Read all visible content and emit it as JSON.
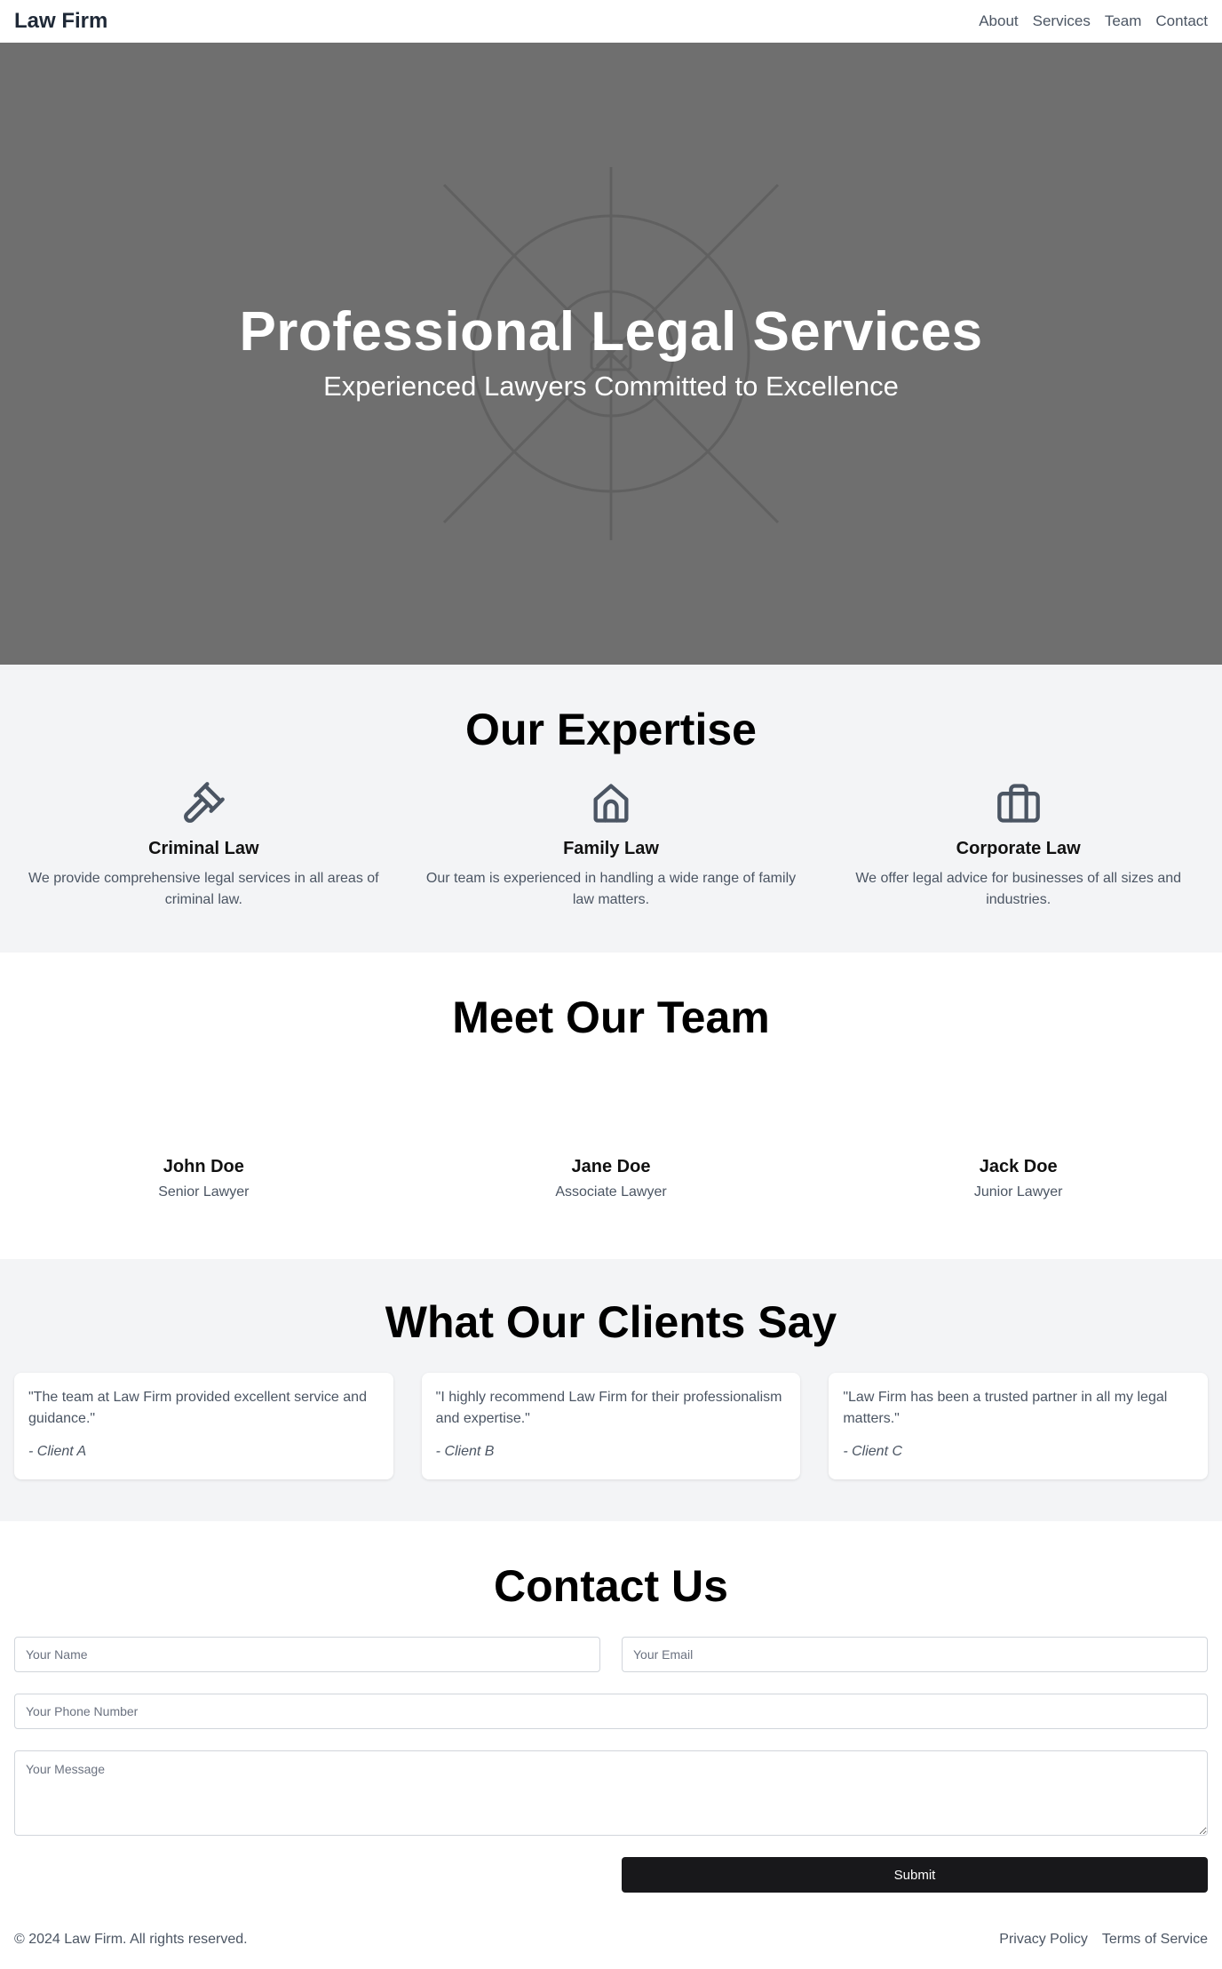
{
  "nav": {
    "brand": "Law Firm",
    "links": [
      "About",
      "Services",
      "Team",
      "Contact"
    ]
  },
  "hero": {
    "title": "Professional Legal Services",
    "subtitle": "Experienced Lawyers Committed to Excellence",
    "placeholder_icon": "image-placeholder-icon"
  },
  "expertise": {
    "title": "Our Expertise",
    "items": [
      {
        "icon": "gavel-icon",
        "name": "Criminal Law",
        "desc": "We provide comprehensive legal services in all areas of criminal law."
      },
      {
        "icon": "home-icon",
        "name": "Family Law",
        "desc": "Our team is experienced in handling a wide range of family law matters."
      },
      {
        "icon": "briefcase-icon",
        "name": "Corporate Law",
        "desc": "We offer legal advice for businesses of all sizes and industries."
      }
    ]
  },
  "team": {
    "title": "Meet Our Team",
    "members": [
      {
        "name": "John Doe",
        "role": "Senior Lawyer"
      },
      {
        "name": "Jane Doe",
        "role": "Associate Lawyer"
      },
      {
        "name": "Jack Doe",
        "role": "Junior Lawyer"
      }
    ]
  },
  "testimonials": {
    "title": "What Our Clients Say",
    "items": [
      {
        "quote": "\"The team at Law Firm provided excellent service and guidance.\"",
        "author": "- Client A"
      },
      {
        "quote": "\"I highly recommend Law Firm for their professionalism and expertise.\"",
        "author": "- Client B"
      },
      {
        "quote": "\"Law Firm has been a trusted partner in all my legal matters.\"",
        "author": "- Client C"
      }
    ]
  },
  "contact": {
    "title": "Contact Us",
    "name_placeholder": "Your Name",
    "email_placeholder": "Your Email",
    "phone_placeholder": "Your Phone Number",
    "message_placeholder": "Your Message",
    "submit_label": "Submit"
  },
  "footer": {
    "copyright": "© 2024 Law Firm. All rights reserved.",
    "links": [
      "Privacy Policy",
      "Terms of Service"
    ]
  },
  "colors": {
    "hero_bg": "#6f6f6f",
    "section_alt_bg": "#f3f4f6",
    "button_bg": "#18181b",
    "muted_text": "#4b5563"
  }
}
